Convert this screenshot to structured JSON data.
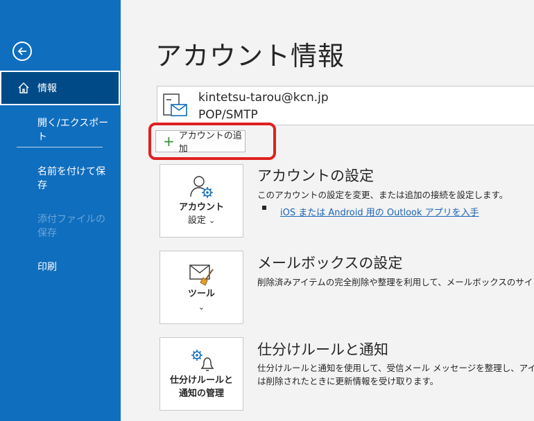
{
  "sidebar": {
    "items": [
      {
        "label": "情報"
      },
      {
        "label": "開く/エクスポート"
      },
      {
        "label": "名前を付けて保存"
      },
      {
        "label": "添付ファイルの保存"
      },
      {
        "label": "印刷"
      }
    ]
  },
  "main": {
    "title": "アカウント情報",
    "account": {
      "email": "kintetsu-tarou@kcn.jp",
      "type": "POP/SMTP"
    },
    "add_account_label": "アカウントの追加",
    "sections": [
      {
        "tile_label_1": "アカウント",
        "tile_label_2": "設定",
        "title": "アカウントの設定",
        "desc_1": "このアカウントの設定を変更、または追加の接続を設定します。",
        "link": "iOS または Android 用の Outlook アプリを入手"
      },
      {
        "tile_label_1": "ツール",
        "title": "メールボックスの設定",
        "desc_1": "削除済みアイテムの完全削除や整理を利用して、メールボックスのサイ"
      },
      {
        "tile_label_1": "仕分けルールと",
        "tile_label_2": "通知の管理",
        "title": "仕分けルールと通知",
        "desc_1": "仕分けルールと通知を使用して、受信メール メッセージを整理し、アイ",
        "desc_2": "は削除されたときに更新情報を受け取ります。"
      }
    ]
  },
  "colors": {
    "sidebar_bg": "#106ebe",
    "sidebar_active_bg": "#004b87",
    "highlight": "#e02020",
    "link": "#1c64b4"
  }
}
